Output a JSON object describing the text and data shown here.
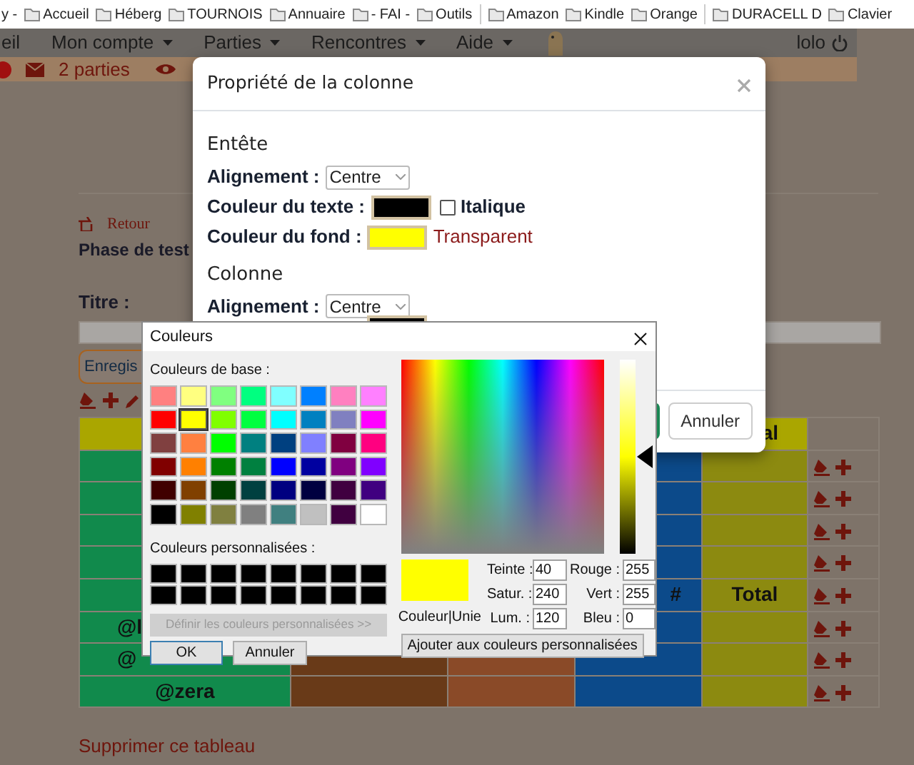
{
  "bookmarks": [
    {
      "kind": "link",
      "label": "y -"
    },
    {
      "kind": "folder",
      "label": "Accueil"
    },
    {
      "kind": "folder",
      "label": "Héberg"
    },
    {
      "kind": "folder",
      "label": "TOURNOIS"
    },
    {
      "kind": "folder",
      "label": "Annuaire"
    },
    {
      "kind": "folder",
      "label": "- FAI -"
    },
    {
      "kind": "folder",
      "label": "Outils"
    },
    {
      "kind": "separator"
    },
    {
      "kind": "folder",
      "label": "Amazon"
    },
    {
      "kind": "folder",
      "label": "Kindle"
    },
    {
      "kind": "folder",
      "label": "Orange"
    },
    {
      "kind": "separator"
    },
    {
      "kind": "folder",
      "label": "DURACELL D"
    },
    {
      "kind": "folder",
      "label": "Clavier"
    }
  ],
  "navbar": {
    "items": [
      {
        "label": "eil",
        "dropdown": false
      },
      {
        "label": "Mon compte",
        "dropdown": true
      },
      {
        "label": "Parties",
        "dropdown": true
      },
      {
        "label": "Rencontres",
        "dropdown": true
      },
      {
        "label": "Aide",
        "dropdown": true
      }
    ],
    "user": "lolo"
  },
  "alert_bar": {
    "games": "2 parties"
  },
  "page": {
    "back_link": "Retour",
    "heading": "Phase de test",
    "title_label": "Titre :",
    "save_button": "Enregis",
    "delete_link": "Supprimer ce tableau"
  },
  "table": {
    "header": {
      "color": "#aaa600"
    },
    "columns": [
      {
        "color": "#118a4c"
      },
      {
        "color": "#693a18"
      },
      {
        "color": "#8a4a28"
      },
      {
        "color": "#0c4a8a"
      },
      {
        "color": "#8c8a10"
      }
    ],
    "rows": [
      {
        "kind": "header",
        "column_5": "al"
      },
      {
        "kind": "body"
      },
      {
        "kind": "body"
      },
      {
        "kind": "body"
      },
      {
        "kind": "body"
      },
      {
        "kind": "body",
        "column_4": "#",
        "column_5": "Total"
      },
      {
        "kind": "body",
        "column_1": "@l"
      },
      {
        "kind": "body",
        "column_1": "@"
      },
      {
        "kind": "body",
        "column_1": "@zera"
      }
    ]
  },
  "modal": {
    "title": "Propriété de la colonne",
    "header_section": {
      "heading": "Entête",
      "alignment_label": "Alignement :",
      "alignment": "Centre",
      "text_color_label": "Couleur du texte :",
      "text_swatch": {
        "color": "#000000"
      },
      "italic_label": "Italique",
      "italic_checked": false,
      "bg_color_label": "Couleur du fond :",
      "bg_swatch": {
        "color": "#ffff00"
      },
      "transparent_link": "Transparent"
    },
    "column_section": {
      "heading": "Colonne",
      "alignment_label": "Alignement :",
      "alignment": "Centre",
      "text_swatch": {
        "color": "#000000"
      }
    },
    "cancel_button": "Annuler"
  },
  "color_dialog": {
    "title": "Couleurs",
    "base_label": "Couleurs de base :",
    "base_colors": [
      {
        "color": "#ff8080",
        "selected": false
      },
      {
        "color": "#ffff80",
        "selected": false
      },
      {
        "color": "#80ff80",
        "selected": false
      },
      {
        "color": "#00ff80",
        "selected": false
      },
      {
        "color": "#80ffff",
        "selected": false
      },
      {
        "color": "#0080ff",
        "selected": false
      },
      {
        "color": "#ff80c0",
        "selected": false
      },
      {
        "color": "#ff80ff",
        "selected": false
      },
      {
        "color": "#ff0000",
        "selected": false
      },
      {
        "color": "#ffff00",
        "selected": true
      },
      {
        "color": "#80ff00",
        "selected": false
      },
      {
        "color": "#00ff40",
        "selected": false
      },
      {
        "color": "#00ffff",
        "selected": false
      },
      {
        "color": "#0080c0",
        "selected": false
      },
      {
        "color": "#8080c0",
        "selected": false
      },
      {
        "color": "#ff00ff",
        "selected": false
      },
      {
        "color": "#804040",
        "selected": false
      },
      {
        "color": "#ff8040",
        "selected": false
      },
      {
        "color": "#00ff00",
        "selected": false
      },
      {
        "color": "#008080",
        "selected": false
      },
      {
        "color": "#004080",
        "selected": false
      },
      {
        "color": "#8080ff",
        "selected": false
      },
      {
        "color": "#800040",
        "selected": false
      },
      {
        "color": "#ff0080",
        "selected": false
      },
      {
        "color": "#800000",
        "selected": false
      },
      {
        "color": "#ff8000",
        "selected": false
      },
      {
        "color": "#008000",
        "selected": false
      },
      {
        "color": "#008040",
        "selected": false
      },
      {
        "color": "#0000ff",
        "selected": false
      },
      {
        "color": "#0000a0",
        "selected": false
      },
      {
        "color": "#800080",
        "selected": false
      },
      {
        "color": "#8000ff",
        "selected": false
      },
      {
        "color": "#400000",
        "selected": false
      },
      {
        "color": "#804000",
        "selected": false
      },
      {
        "color": "#004000",
        "selected": false
      },
      {
        "color": "#004040",
        "selected": false
      },
      {
        "color": "#000080",
        "selected": false
      },
      {
        "color": "#000040",
        "selected": false
      },
      {
        "color": "#400040",
        "selected": false
      },
      {
        "color": "#400080",
        "selected": false
      },
      {
        "color": "#000000",
        "selected": false
      },
      {
        "color": "#808000",
        "selected": false
      },
      {
        "color": "#808040",
        "selected": false
      },
      {
        "color": "#808080",
        "selected": false
      },
      {
        "color": "#408080",
        "selected": false
      },
      {
        "color": "#c0c0c0",
        "selected": false
      },
      {
        "color": "#400040",
        "selected": false
      },
      {
        "color": "#ffffff",
        "selected": false
      }
    ],
    "custom_label": "Couleurs personnalisées :",
    "custom_colors": [
      {
        "color": "#000000"
      },
      {
        "color": "#000000"
      },
      {
        "color": "#000000"
      },
      {
        "color": "#000000"
      },
      {
        "color": "#000000"
      },
      {
        "color": "#000000"
      },
      {
        "color": "#000000"
      },
      {
        "color": "#000000"
      },
      {
        "color": "#000000"
      },
      {
        "color": "#000000"
      },
      {
        "color": "#000000"
      },
      {
        "color": "#000000"
      },
      {
        "color": "#000000"
      },
      {
        "color": "#000000"
      },
      {
        "color": "#000000"
      },
      {
        "color": "#000000"
      }
    ],
    "define_button": {
      "label": "Définir les couleurs personnalisées >>",
      "disabled": true
    },
    "ok_button": "OK",
    "cancel_button": "Annuler",
    "luminance": {
      "level": 0.5
    },
    "preview": {
      "color": "#ffff00"
    },
    "preview_label": "Couleur|Unie",
    "fields": [
      {
        "label": "Teinte :",
        "value": "40"
      },
      {
        "label": "Rouge :",
        "value": "255"
      },
      {
        "label": "Satur. :",
        "value": "240"
      },
      {
        "label": "Vert :",
        "value": "255"
      },
      {
        "label": "Lum. :",
        "value": "120"
      },
      {
        "label": "Bleu :",
        "value": "0"
      }
    ],
    "add_button": "Ajouter aux couleurs personnalisées"
  }
}
